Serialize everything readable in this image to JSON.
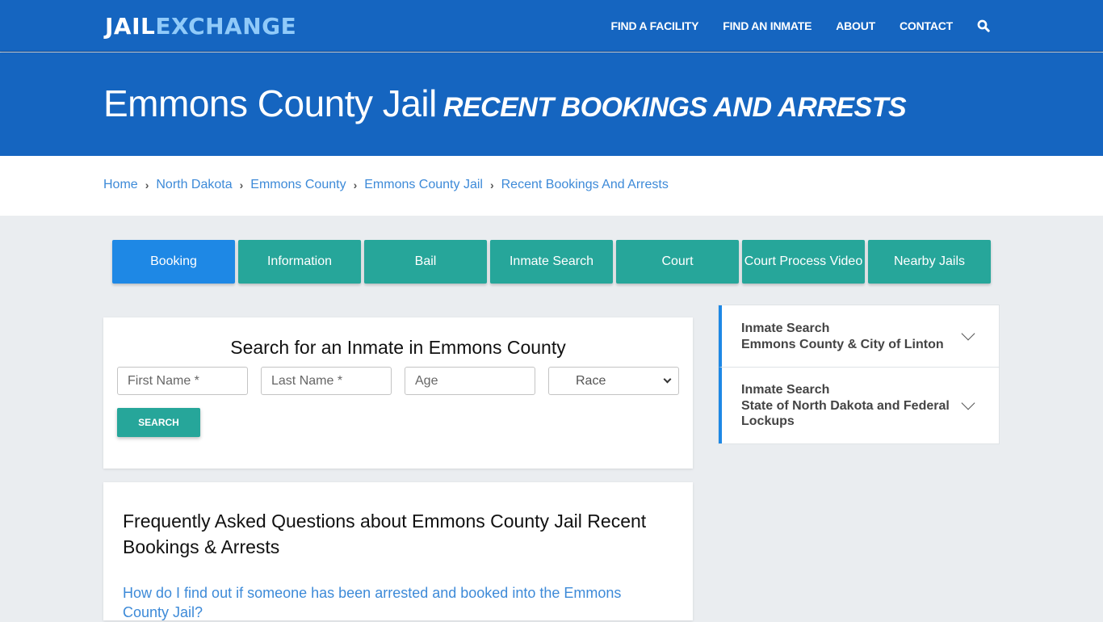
{
  "header": {
    "logo_part1": "JAIL",
    "logo_part2": "EXCHANGE",
    "nav": [
      {
        "label": "FIND A FACILITY"
      },
      {
        "label": "FIND AN INMATE"
      },
      {
        "label": "ABOUT"
      },
      {
        "label": "CONTACT"
      }
    ],
    "search_icon": "search-icon"
  },
  "banner": {
    "title": "Emmons County Jail",
    "subtitle": "RECENT BOOKINGS AND ARRESTS"
  },
  "breadcrumb": [
    {
      "label": "Home"
    },
    {
      "label": "North Dakota"
    },
    {
      "label": "Emmons County"
    },
    {
      "label": "Emmons County Jail"
    },
    {
      "label": "Recent Bookings And Arrests"
    }
  ],
  "tabs": [
    {
      "label": "Booking",
      "active": true
    },
    {
      "label": "Information"
    },
    {
      "label": "Bail"
    },
    {
      "label": "Inmate Search"
    },
    {
      "label": "Court"
    },
    {
      "label": "Court Process Video"
    },
    {
      "label": "Nearby Jails"
    }
  ],
  "search": {
    "title": "Search for an Inmate in Emmons County",
    "first_name_placeholder": "First Name *",
    "last_name_placeholder": "Last Name *",
    "age_placeholder": "Age",
    "race_selected": "Race",
    "button": "SEARCH"
  },
  "faq": {
    "heading": "Frequently Asked Questions about Emmons County Jail Recent Bookings & Arrests",
    "question1": "How do I find out if someone has been arrested and booked into the Emmons County Jail?"
  },
  "sidebar": {
    "items": [
      {
        "line1": "Inmate Search",
        "line2": "Emmons County & City of Linton"
      },
      {
        "line1": "Inmate Search",
        "line2": "State of North Dakota and Federal Lockups"
      }
    ]
  },
  "colors": {
    "header_blue": "#1565c0",
    "logo_accent": "#90caf9",
    "tab_teal": "#26a69a",
    "tab_active_blue": "#1e88e5",
    "link_blue": "#3d8ad8",
    "page_bg": "#eaedf0"
  }
}
